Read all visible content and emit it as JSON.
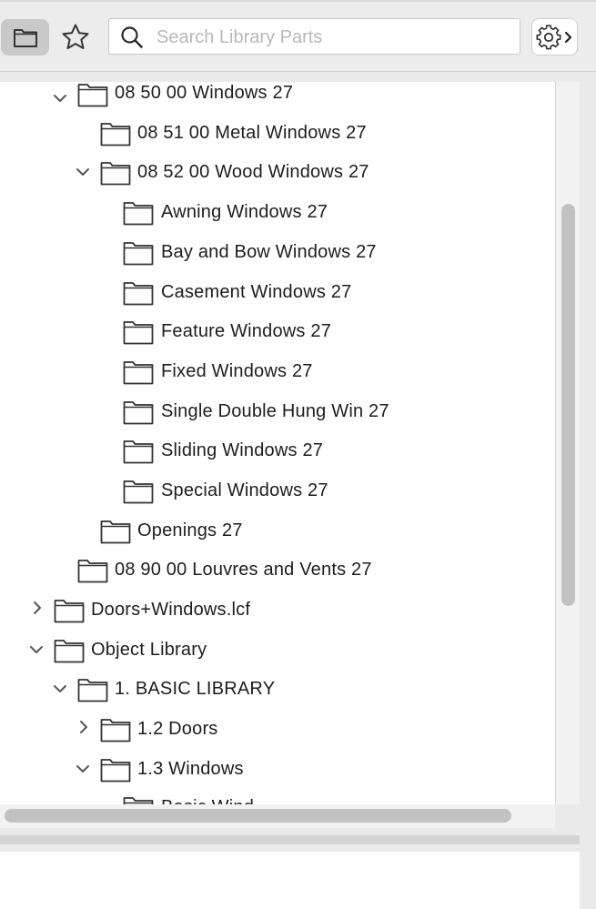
{
  "toolbar": {
    "folder_view_icon": "folder-icon",
    "favorites_icon": "star-icon",
    "search": {
      "placeholder": "Search Library Parts",
      "value": ""
    },
    "settings_icon": "gear-icon"
  },
  "tree": [
    {
      "label": "08 50 00 Windows 27",
      "expanded": true
    },
    {
      "label": "08 51 00 Metal Windows 27"
    },
    {
      "label": "08 52 00 Wood Windows 27",
      "expanded": true
    },
    {
      "label": "Awning Windows 27"
    },
    {
      "label": "Bay and Bow Windows 27"
    },
    {
      "label": "Casement Windows 27"
    },
    {
      "label": "Feature Windows 27"
    },
    {
      "label": "Fixed Windows 27"
    },
    {
      "label": "Single Double Hung Win 27"
    },
    {
      "label": "Sliding Windows 27"
    },
    {
      "label": "Special Windows 27"
    },
    {
      "label": "Openings 27"
    },
    {
      "label": "08 90 00 Louvres and Vents 27"
    },
    {
      "label": "Doors+Windows.lcf",
      "expanded": false
    },
    {
      "label": "Object Library",
      "expanded": true
    },
    {
      "label": "1. BASIC LIBRARY",
      "expanded": true
    },
    {
      "label": "1.2 Doors",
      "expanded": false
    },
    {
      "label": "1.3 Windows",
      "expanded": true
    },
    {
      "label": "Basic Wind"
    }
  ],
  "colors": {
    "panel_bg": "#ffffff",
    "toolbar_bg": "#ececec",
    "selected_button_bg": "#c9c9c9",
    "scrollbar_thumb": "#c2c2c2"
  }
}
